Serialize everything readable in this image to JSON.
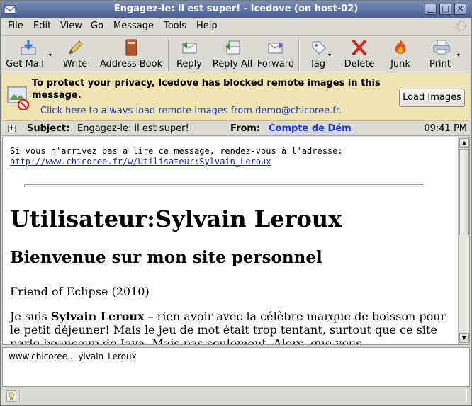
{
  "window": {
    "title": "Engagez-le: il est super! - Icedove (on host-02)",
    "controls": {
      "minimize": "▁",
      "maximize": "□",
      "close": "✕"
    }
  },
  "menu": [
    "File",
    "Edit",
    "View",
    "Go",
    "Message",
    "Tools",
    "Help"
  ],
  "toolbar": {
    "get_mail": "Get Mail",
    "write": "Write",
    "address_book": "Address Book",
    "reply": "Reply",
    "reply_all": "Reply All",
    "forward": "Forward",
    "tag": "Tag",
    "delete": "Delete",
    "junk": "Junk",
    "print": "Print",
    "dropdown_glyph": "▾"
  },
  "notice": {
    "message": "To protect your privacy, Icedove has blocked remote images in this message.",
    "link": "Click here to always load remote images from demo@chicoree.fr.",
    "button": "Load Images"
  },
  "header": {
    "twisty": "+",
    "subject_label": "Subject:",
    "subject": "Engagez-le: il est super!",
    "from_label": "From:",
    "from": "Compte de Démo",
    "time": "09:41 PM"
  },
  "message": {
    "intro": "Si vous n'arrivez pas à lire ce message, rendez-vous à l'adresse:",
    "url": "http://www.chicoree.fr/w/Utilisateur:Sylvain_Leroux",
    "h1": "Utilisateur:Sylvain Leroux",
    "h2": "Bienvenue sur mon site personnel",
    "p1": "Friend of Eclipse (2010)",
    "p2_start": "Je suis ",
    "p2_bold": "Sylvain Leroux",
    "p2_rest": " – rien avoir avec la célèbre marque de boisson pour le petit déjeuner! Mais le jeu de mot était trop tentant, surtout que ce site parle beaucoup de Java. Mais pas seulement. Alors, que vous"
  },
  "scrollbar": {
    "up": "▲",
    "down": "▼"
  },
  "url_pane": "www.chicoree....ylvain_Leroux",
  "colors": {
    "titlebar": "#4a5f92",
    "notice_bg": "#f1e4b4",
    "link": "#1a3cc8"
  }
}
